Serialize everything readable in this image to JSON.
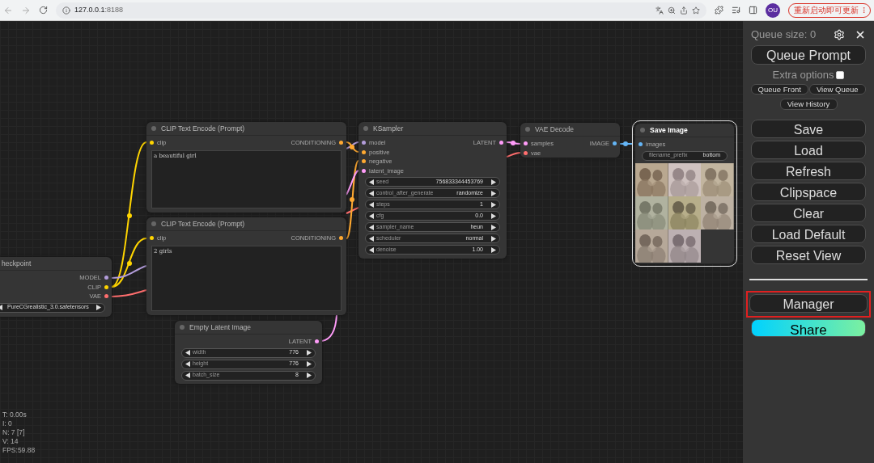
{
  "browser": {
    "url_host": "127.0.0.1",
    "url_port": ":8188",
    "profile": "OU",
    "update_button": "重新启动即可更新"
  },
  "nodes": [
    {
      "title": "CLIP Text Encode (Prompt)",
      "selected": false,
      "inputs": [
        {
          "name": "clip",
          "color": "#ffd500"
        }
      ],
      "outputs": [
        {
          "name": "CONDITIONING",
          "color": "#ffa931"
        }
      ],
      "text": "a beautiful girl"
    },
    {
      "title": "KSampler",
      "selected": false,
      "inputs": [
        {
          "name": "model",
          "color": "#b39ddb"
        },
        {
          "name": "positive",
          "color": "#ffa931"
        },
        {
          "name": "negative",
          "color": "#ffa931"
        },
        {
          "name": "latent_image",
          "color": "#ff9cf9"
        }
      ],
      "outputs": [
        {
          "name": "LATENT",
          "color": "#ff9cf9"
        }
      ],
      "widgets": [
        {
          "kind": "stepper",
          "name": "seed",
          "value": "756833344453769"
        },
        {
          "kind": "stepper",
          "name": "control_after_generate",
          "value": "randomize"
        },
        {
          "kind": "stepper",
          "name": "steps",
          "value": "1"
        },
        {
          "kind": "stepper",
          "name": "cfg",
          "value": "0.0"
        },
        {
          "kind": "stepper",
          "name": "sampler_name",
          "value": "heun"
        },
        {
          "kind": "stepper",
          "name": "scheduler",
          "value": "normal"
        },
        {
          "kind": "stepper",
          "name": "denoise",
          "value": "1.00"
        }
      ]
    },
    {
      "title": "VAE Decode",
      "selected": false,
      "inputs": [
        {
          "name": "samples",
          "color": "#ff9cf9"
        },
        {
          "name": "vae",
          "color": "#ff6e6e"
        }
      ],
      "outputs": [
        {
          "name": "IMAGE",
          "color": "#64b5f6"
        }
      ]
    },
    {
      "title": "Save Image",
      "selected": true,
      "inputs": [
        {
          "name": "images",
          "color": "#64b5f6"
        }
      ],
      "widgets": [
        {
          "kind": "text",
          "name": "filename_prefix",
          "value": "bottom"
        }
      ],
      "previews": [
        {
          "kind": "picture"
        },
        {
          "kind": "picture"
        },
        {
          "kind": "picture"
        },
        {
          "kind": "picture"
        },
        {
          "kind": "picture"
        },
        {
          "kind": "picture"
        },
        {
          "kind": "picture"
        },
        {
          "kind": "picture"
        }
      ]
    },
    {
      "title": "CLIP Text Encode (Prompt)",
      "selected": false,
      "inputs": [
        {
          "name": "clip",
          "color": "#ffd500"
        }
      ],
      "outputs": [
        {
          "name": "CONDITIONING",
          "color": "#ffa931"
        }
      ],
      "text": "2 girls"
    },
    {
      "title": "heckpoint",
      "selected": false,
      "outputs": [
        {
          "name": "MODEL",
          "color": "#b39ddb"
        },
        {
          "name": "CLIP",
          "color": "#ffd500"
        },
        {
          "name": "VAE",
          "color": "#ff6e6e"
        }
      ],
      "widgets": [
        {
          "kind": "stepper",
          "value": "PureCGrealistic_3.0.safetensors"
        }
      ]
    },
    {
      "title": "Empty Latent Image",
      "selected": false,
      "outputs": [
        {
          "name": "LATENT",
          "color": "#ff9cf9"
        }
      ],
      "widgets": [
        {
          "kind": "stepper",
          "name": "width",
          "value": "776"
        },
        {
          "kind": "stepper",
          "name": "height",
          "value": "776"
        },
        {
          "kind": "stepper",
          "name": "batch_size",
          "value": "8"
        }
      ]
    }
  ],
  "stats": [
    "T: 0.00s",
    "I: 0",
    "N: 7 [7]",
    "V: 14",
    "FPS:59.88"
  ],
  "menu": {
    "queue_size": "Queue size: 0",
    "queue_prompt": "Queue Prompt",
    "extra_options": {
      "label": "Extra options",
      "checked": false
    },
    "queue_front": "Queue Front",
    "view_queue": "View Queue",
    "view_history": "View History",
    "buttons": [
      "Save",
      "Load",
      "Refresh",
      "Clipspace",
      "Clear",
      "Load Default",
      "Reset View"
    ],
    "manager": {
      "label": "Manager",
      "highlighted": true
    },
    "share": "Share"
  }
}
